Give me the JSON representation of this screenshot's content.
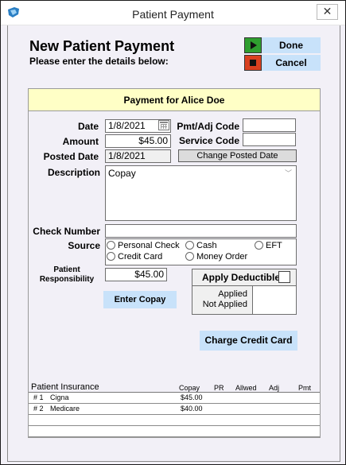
{
  "window": {
    "title": "Patient Payment",
    "close_symbol": "✕"
  },
  "header": {
    "title": "New Patient Payment",
    "subtitle": "Please enter the details below:",
    "done_label": "Done",
    "cancel_label": "Cancel"
  },
  "panel": {
    "title": "Payment for Alice Doe"
  },
  "form": {
    "date_label": "Date",
    "date_value": "1/8/2021",
    "amount_label": "Amount",
    "amount_value": "$45.00",
    "posted_date_label": "Posted Date",
    "posted_date_value": "1/8/2021",
    "pmt_adj_code_label": "Pmt/Adj Code",
    "pmt_adj_code_value": "",
    "service_code_label": "Service Code",
    "service_code_value": "",
    "change_posted_date_label": "Change Posted Date",
    "description_label": "Description",
    "description_value": "Copay",
    "check_number_label": "Check Number",
    "check_number_value": "",
    "source_label": "Source",
    "source_options": [
      "Personal Check",
      "Cash",
      "EFT",
      "Credit Card",
      "Money Order"
    ],
    "patient_resp_label_1": "Patient",
    "patient_resp_label_2": "Responsibility",
    "patient_resp_value": "$45.00",
    "enter_copay_label": "Enter Copay",
    "apply_deductible_label": "Apply Deductible",
    "applied_label": "Applied",
    "not_applied_label": "Not Applied",
    "charge_card_label": "Charge Credit Card"
  },
  "insurance": {
    "headers": [
      "Patient Insurance",
      "Copay",
      "PR",
      "Allwed",
      "Adj",
      "Pmt"
    ],
    "rows": [
      {
        "num": "# 1",
        "name": "Cigna",
        "copay": "$45.00"
      },
      {
        "num": "# 2",
        "name": "Medicare",
        "copay": "$40.00"
      }
    ]
  }
}
